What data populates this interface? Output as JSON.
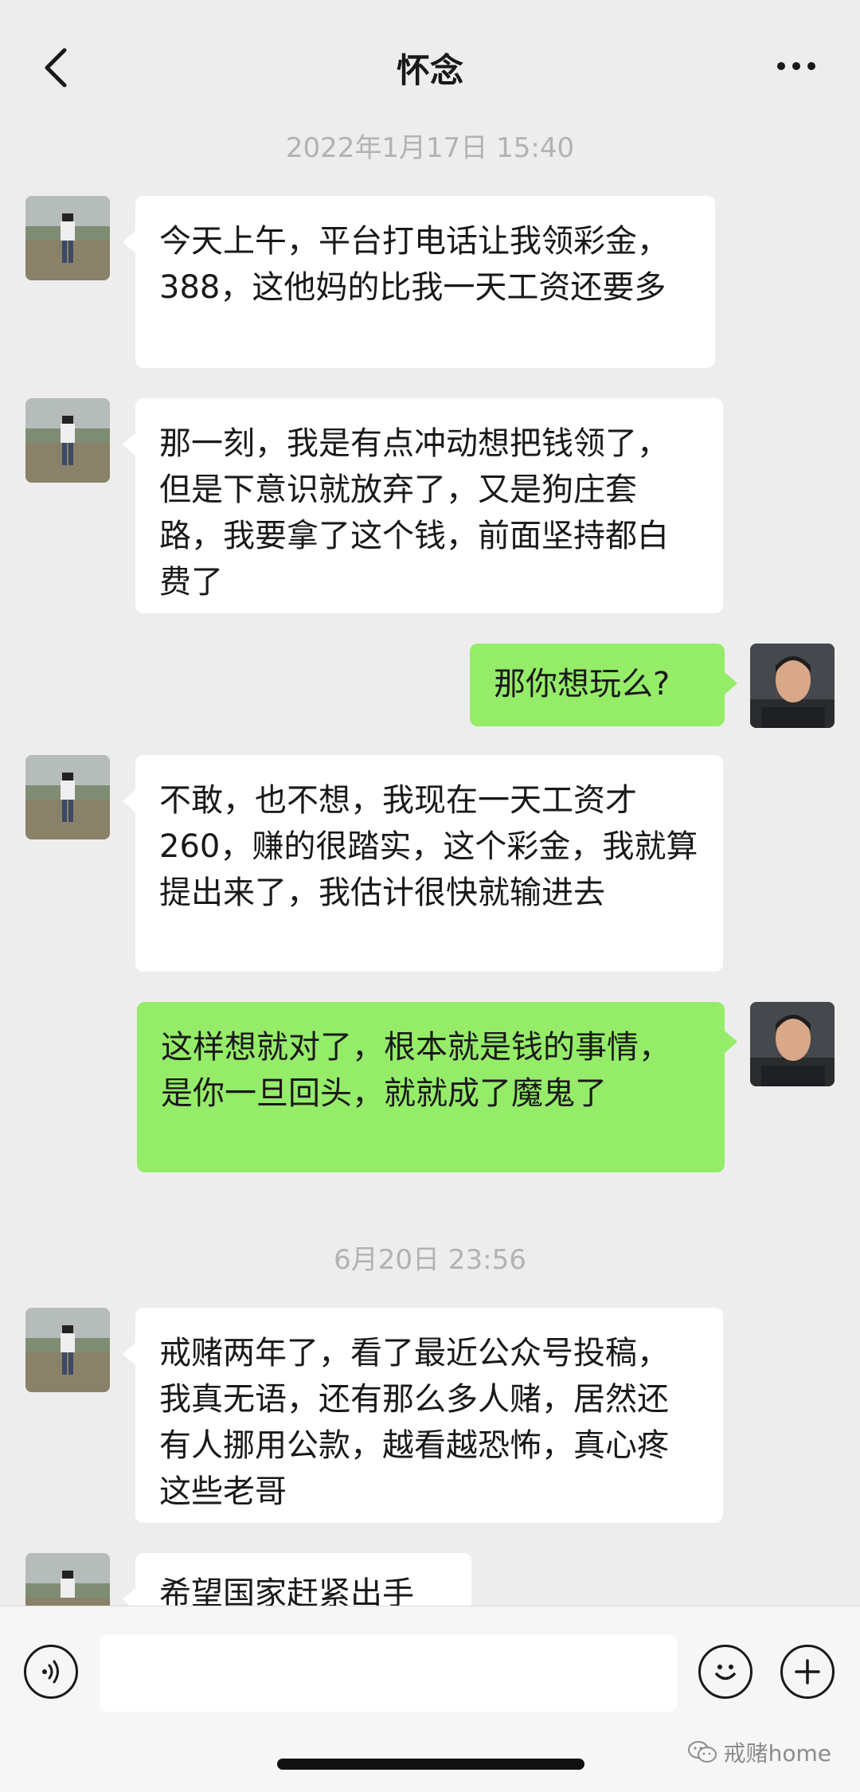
{
  "header": {
    "title": "怀念",
    "back_icon": "chevron-left-icon",
    "more_icon": "more-dots-icon"
  },
  "timestamps": [
    "2022年1月17日 15:40",
    "6月20日 23:56"
  ],
  "messages": [
    {
      "from": "other",
      "text": "今天上午，平台打电话让我领彩金，388，这他妈的比我一天工资还要多"
    },
    {
      "from": "other",
      "text": "那一刻，我是有点冲动想把钱领了，但是下意识就放弃了，又是狗庄套路，我要拿了这个钱，前面坚持都白费了"
    },
    {
      "from": "self",
      "text": "那你想玩么?"
    },
    {
      "from": "other",
      "text": "不敢，也不想，我现在一天工资才 260，赚的很踏实，这个彩金，我就算提出来了，我估计很快就输进去"
    },
    {
      "from": "self",
      "text": "这样想就对了，根本就是钱的事情，是你一旦回头，就就成了魔鬼了"
    },
    {
      "from": "other",
      "text": "戒赌两年了，看了最近公众号投稿，我真无语，还有那么多人赌，居然还有人挪用公款，越看越恐怖，真心疼这些老哥"
    },
    {
      "from": "other",
      "text": "希望国家赶紧出手"
    }
  ],
  "composer": {
    "input_value": "",
    "voice_icon": "voice-icon",
    "emoji_icon": "emoji-icon",
    "plus_icon": "plus-icon"
  },
  "watermark": "戒赌home",
  "colors": {
    "background": "#ededed",
    "bubble_in": "#ffffff",
    "bubble_out": "#95ec69",
    "timestamp": "#b2b2b2"
  }
}
